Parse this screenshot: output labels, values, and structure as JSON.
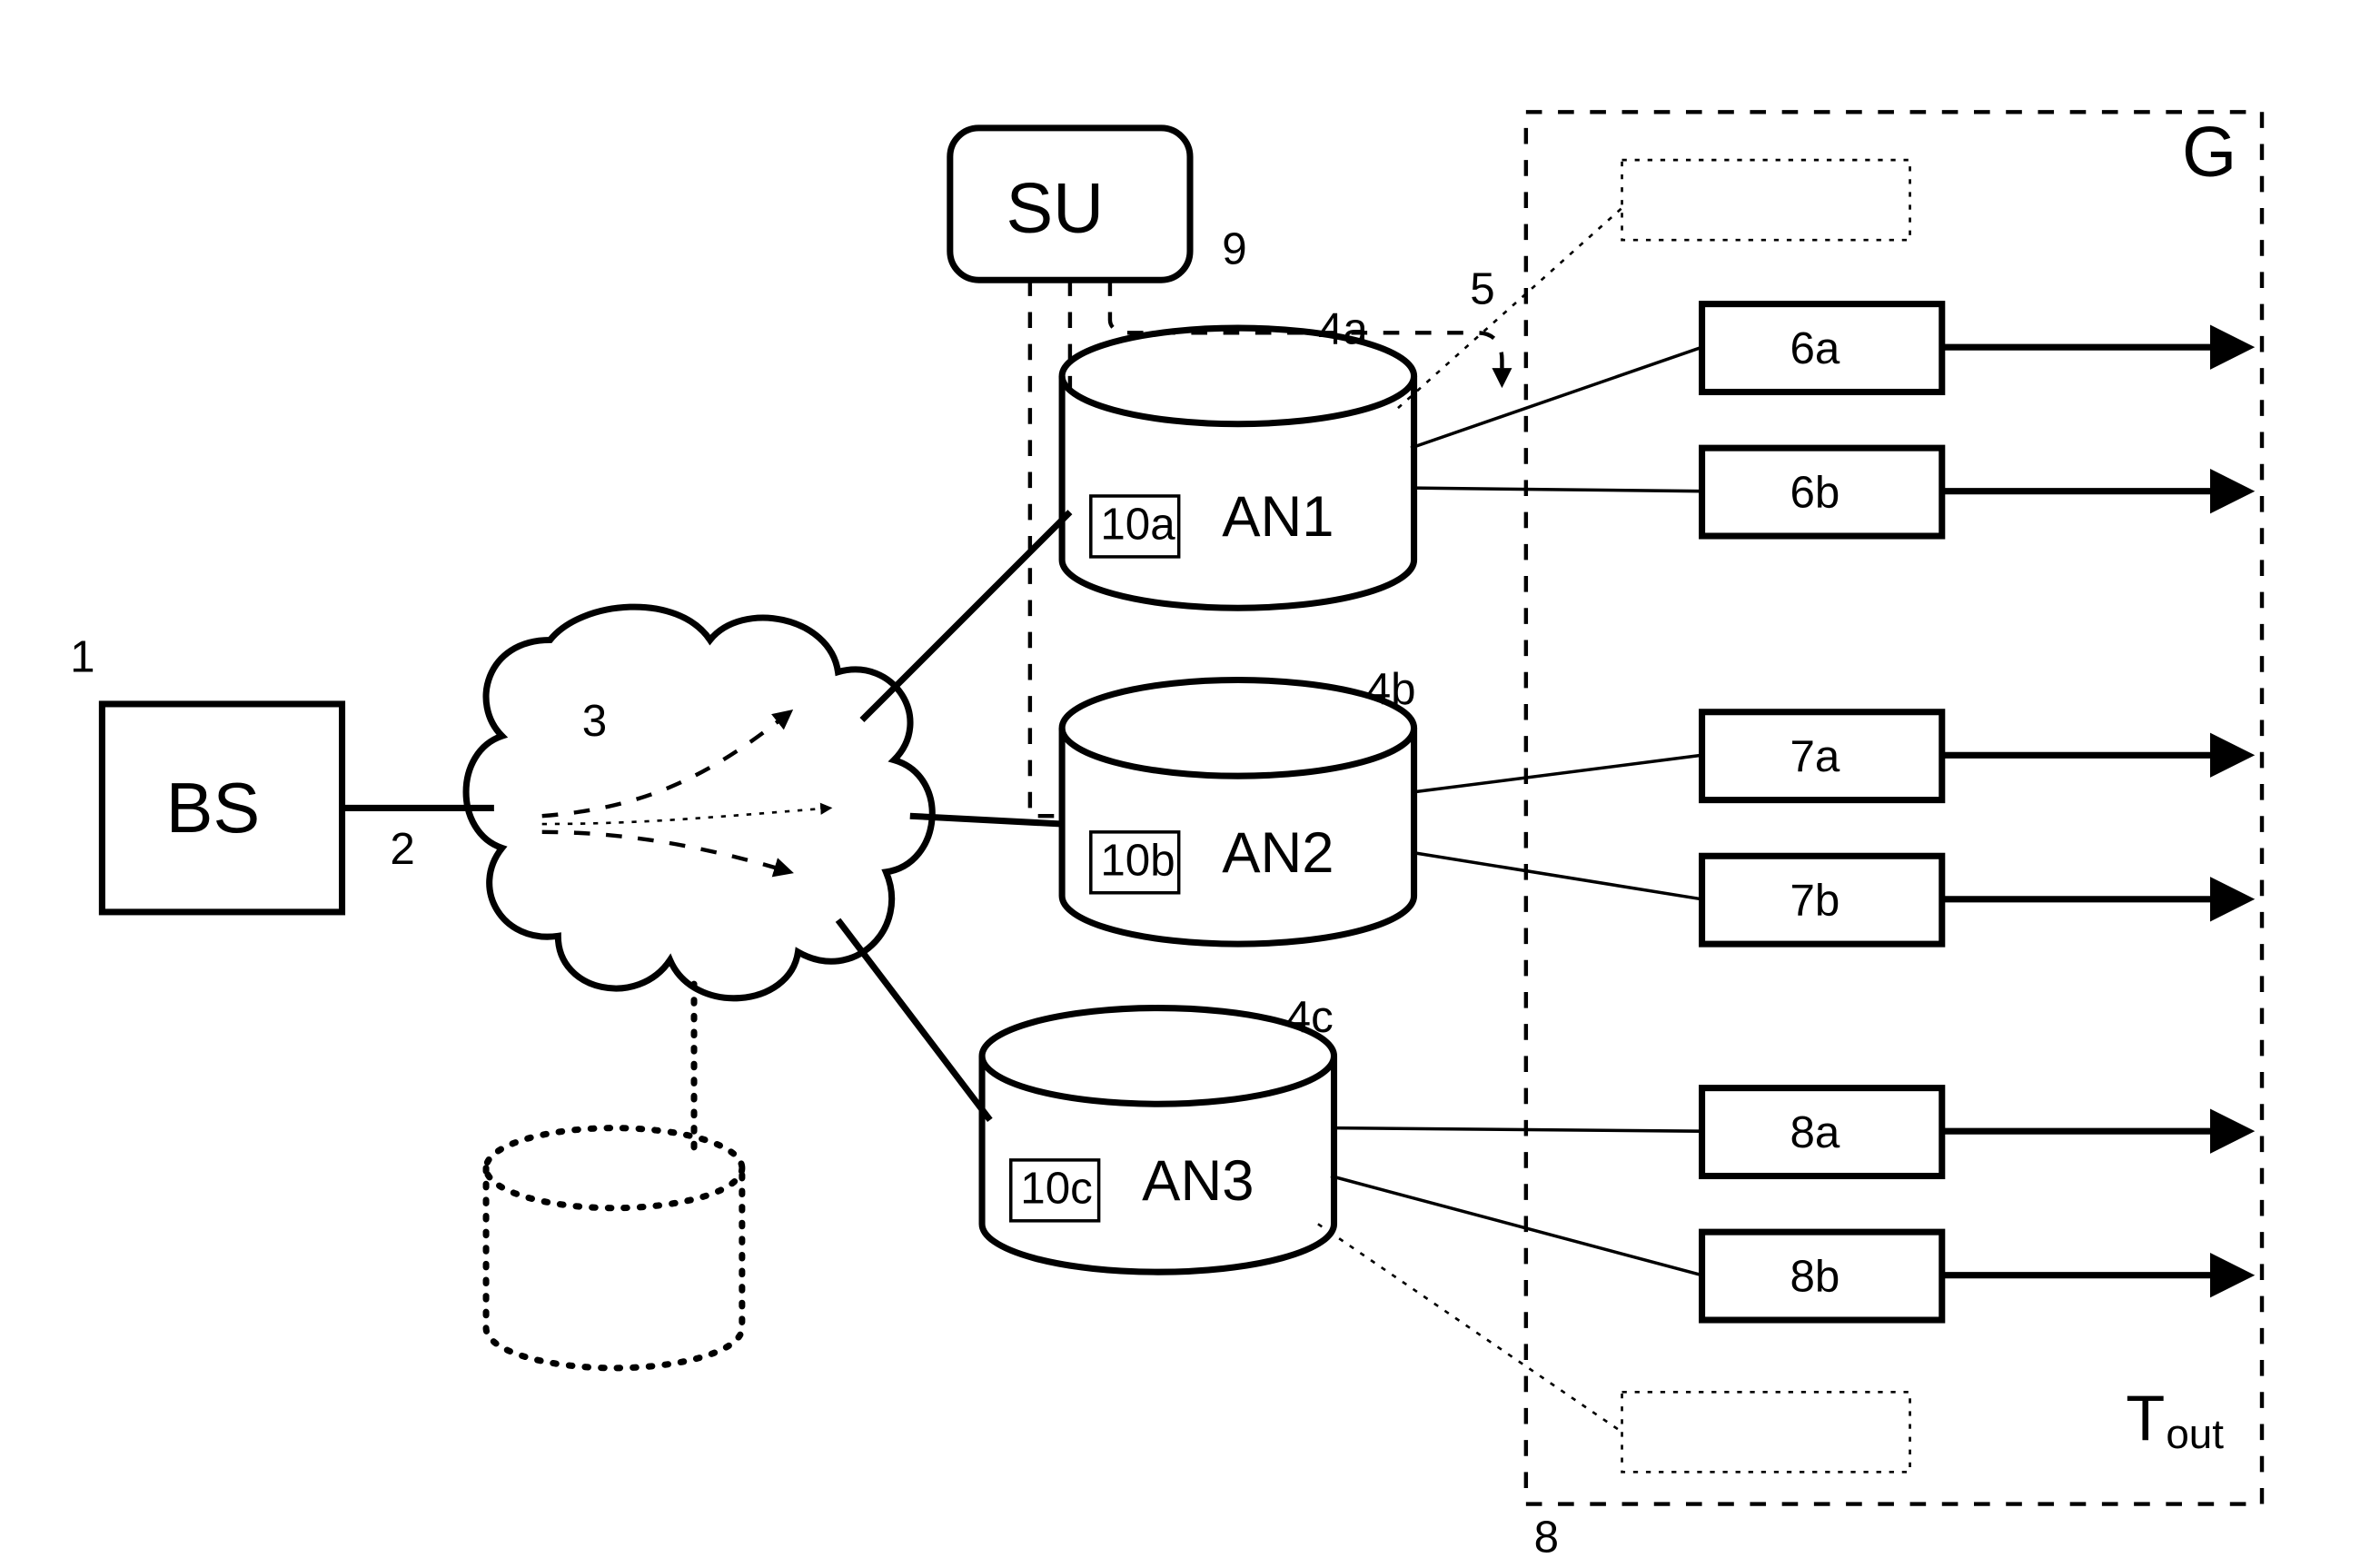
{
  "labels": {
    "bs": "BS",
    "su": "SU",
    "an1": "AN1",
    "an2": "AN2",
    "an3": "AN3",
    "g": "G",
    "t": "T",
    "out": "out",
    "n1": "1",
    "n2": "2",
    "n3": "3",
    "n4a": "4a",
    "n4b": "4b",
    "n4c": "4c",
    "n5": "5",
    "n6a": "6a",
    "n6b": "6b",
    "n7a": "7a",
    "n7b": "7b",
    "n8a": "8a",
    "n8b": "8b",
    "n8": "8",
    "n9": "9",
    "n10a": "10a",
    "n10b": "10b",
    "n10c": "10c"
  }
}
